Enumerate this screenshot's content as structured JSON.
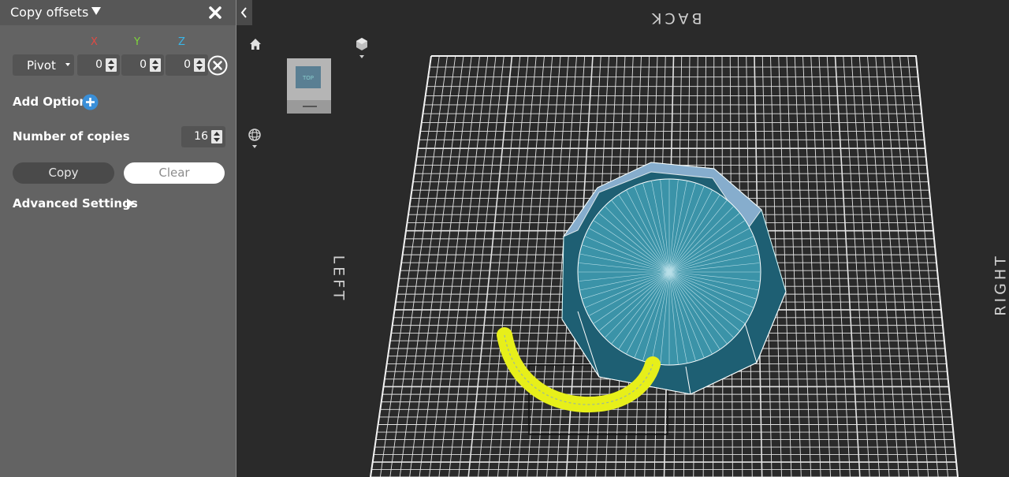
{
  "panel": {
    "title": "Copy offsets",
    "axes": {
      "x": "X",
      "y": "Y",
      "z": "Z"
    },
    "pivot_label": "Pivot",
    "offsets": {
      "x": "0",
      "y": "0",
      "z": "0"
    },
    "add_option_label": "Add Option",
    "copies_label": "Number of copies",
    "copies_value": "16",
    "copy_label": "Copy",
    "clear_label": "Clear",
    "advanced_label": "Advanced Settings"
  },
  "viewport": {
    "nav_cube_face": "TOP",
    "labels": {
      "back": "BACK",
      "left": "LEFT",
      "right": "RIGHT"
    }
  },
  "colors": {
    "axis_x": "#e04a44",
    "axis_y": "#7ed63a",
    "axis_z": "#3ab4e6",
    "accent": "#3a8fd8",
    "model": "#3a8ea3",
    "highlight": "#e7ef1a"
  }
}
